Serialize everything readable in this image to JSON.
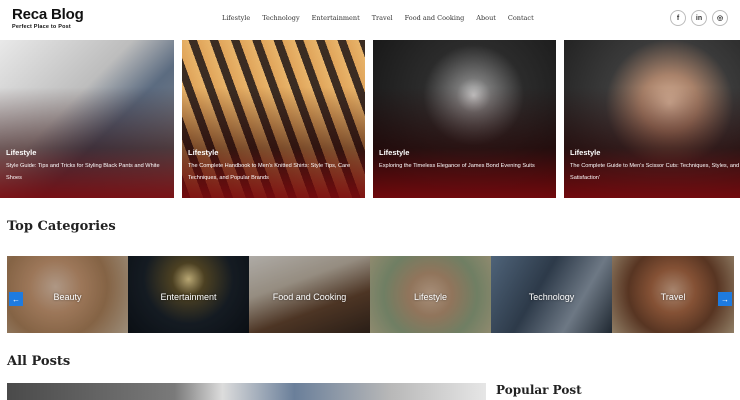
{
  "header": {
    "logo_text": "Reca Blog",
    "logo_tagline": "Perfect Place to Post",
    "nav": [
      "Lifestyle",
      "Technology",
      "Entertainment",
      "Travel",
      "Food and Cooking",
      "About",
      "Contact"
    ],
    "social": [
      {
        "icon": "facebook-icon",
        "glyph": "f"
      },
      {
        "icon": "linkedin-icon",
        "glyph": "in"
      },
      {
        "icon": "instagram-icon",
        "glyph": "◎"
      }
    ]
  },
  "featured_posts": [
    {
      "category": "Lifestyle",
      "title": "Style Guide: Tips and Tricks for Styling Black Pants and White Shoes"
    },
    {
      "category": "Lifestyle",
      "title": "The Complete Handbook to Men's Knitted Shirts: Style Tips, Care Techniques, and Popular Brands"
    },
    {
      "category": "Lifestyle",
      "title": "Exploring the Timeless Elegance of James Bond Evening Suits"
    },
    {
      "category": "Lifestyle",
      "title": "The Complete Guide to Men's Scissor Cuts: Techniques, Styles, and Satisfaction'"
    }
  ],
  "top_categories": {
    "title": "Top Categories",
    "items": [
      "Beauty",
      "Entertainment",
      "Food and Cooking",
      "Lifestyle",
      "Technology",
      "Travel"
    ],
    "prev_glyph": "←",
    "next_glyph": "→"
  },
  "all_posts": {
    "title": "All Posts",
    "popular_title": "Popular Post"
  },
  "colors": {
    "accent": "#1e7be0",
    "card_overlay": "#7a080c"
  }
}
